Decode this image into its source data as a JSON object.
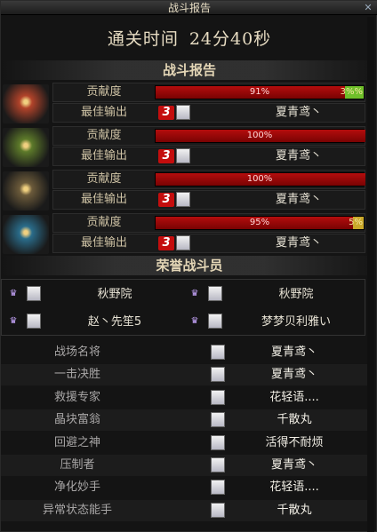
{
  "window": {
    "title": "战斗报告",
    "close_label": "✕"
  },
  "clear_time": {
    "label": "通关时间",
    "value": "24分40秒"
  },
  "battle_report": {
    "title": "战斗报告",
    "contribution_label": "贡献度",
    "best_output_label": "最佳输出",
    "players": [
      {
        "avatar_color": "#b1432a",
        "contribution_pct": 91,
        "contribution_text": "91%",
        "extra_text": "3%%",
        "extra_color": "#6fbf2a",
        "rank": "3",
        "best_player": "夏青鸢丶"
      },
      {
        "avatar_color": "#5d7a2a",
        "contribution_pct": 100,
        "contribution_text": "100%",
        "extra_text": "",
        "extra_color": "",
        "rank": "3",
        "best_player": "夏青鸢丶"
      },
      {
        "avatar_color": "#6b5a3a",
        "contribution_pct": 100,
        "contribution_text": "100%",
        "extra_text": "",
        "extra_color": "",
        "rank": "3",
        "best_player": "夏青鸢丶"
      },
      {
        "avatar_color": "#2a6c8a",
        "contribution_pct": 95,
        "contribution_text": "95%",
        "extra_text": "5%",
        "extra_color": "#c9a82a",
        "rank": "3",
        "best_player": "夏青鸢丶"
      }
    ]
  },
  "honor": {
    "title": "荣誉战斗员",
    "members": [
      "秋野院",
      "秋野院",
      "赵丶先笙5",
      "梦梦贝利雅い"
    ]
  },
  "awards": [
    {
      "title": "战场名将",
      "winner": "夏青鸢丶"
    },
    {
      "title": "一击决胜",
      "winner": "夏青鸢丶"
    },
    {
      "title": "救援专家",
      "winner": "花轻语...."
    },
    {
      "title": "晶块富翁",
      "winner": "千散丸"
    },
    {
      "title": "回避之神",
      "winner": "活得不耐烦"
    },
    {
      "title": "压制者",
      "winner": "夏青鸢丶"
    },
    {
      "title": "净化妙手",
      "winner": "花轻语...."
    },
    {
      "title": "异常状态能手",
      "winner": "千散丸"
    }
  ]
}
